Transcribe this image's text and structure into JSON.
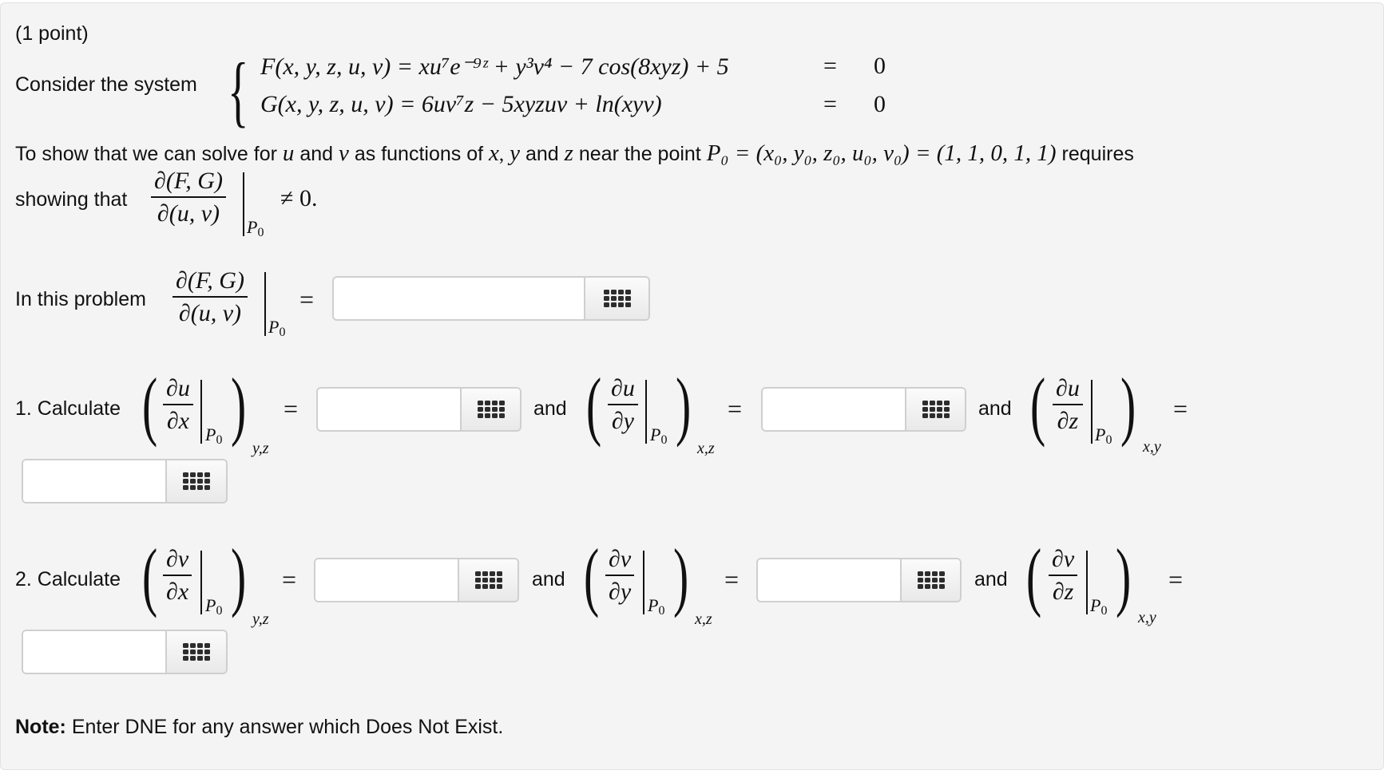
{
  "problem": {
    "points_label": "(1 point)",
    "intro": "Consider the system",
    "system": {
      "F_lhs": "F(x, y, z, u, v) =",
      "F_rhs": "xu⁷e⁻⁹ᶻ + y³v⁴ − 7 cos(8xyz) + 5",
      "F_eq": "=",
      "F_val": "0",
      "G_lhs": "G(x, y, z, u, v) =",
      "G_rhs": "6uv⁷z − 5xyzuv + ln(xyv)",
      "G_eq": "=",
      "G_val": "0"
    },
    "statement_1": "To show that we can solve for",
    "var_u": "u",
    "and": "and",
    "var_v": "v",
    "statement_2": "as functions of",
    "var_x": "x",
    "comma": ",",
    "var_y": "y",
    "var_z": "z",
    "statement_3": "near the point",
    "point": "P₀ = (x₀, y₀, z₀, u₀, v₀) = (1, 1, 0, 1, 1)",
    "requires": "requires",
    "showing_that": "showing that",
    "jacobian_num": "∂(F, G)",
    "jacobian_den": "∂(u, v)",
    "eval_point": "P",
    "eval_sub": "0",
    "neq_zero": "≠ 0.",
    "in_this_problem": "In this problem",
    "equals": "="
  },
  "answers": {
    "jacobian": {
      "value": "",
      "placeholder": ""
    },
    "q1": {
      "label": "1. Calculate",
      "items": [
        {
          "num": "∂u",
          "den": "∂x",
          "held": "y,z",
          "value": ""
        },
        {
          "num": "∂u",
          "den": "∂y",
          "held": "x,z",
          "value": ""
        },
        {
          "num": "∂u",
          "den": "∂z",
          "held": "x,y",
          "value": ""
        }
      ]
    },
    "q2": {
      "label": "2. Calculate",
      "items": [
        {
          "num": "∂v",
          "den": "∂x",
          "held": "y,z",
          "value": ""
        },
        {
          "num": "∂v",
          "den": "∂y",
          "held": "x,z",
          "value": ""
        },
        {
          "num": "∂v",
          "den": "∂z",
          "held": "x,y",
          "value": ""
        }
      ]
    },
    "keypad_icon": "keypad-grid-icon"
  },
  "note": {
    "bold": "Note:",
    "text": " Enter DNE for any answer which Does Not Exist."
  },
  "colors": {
    "panel_bg": "#f4f4f4",
    "border": "#cfcfcf",
    "text": "#111111"
  }
}
